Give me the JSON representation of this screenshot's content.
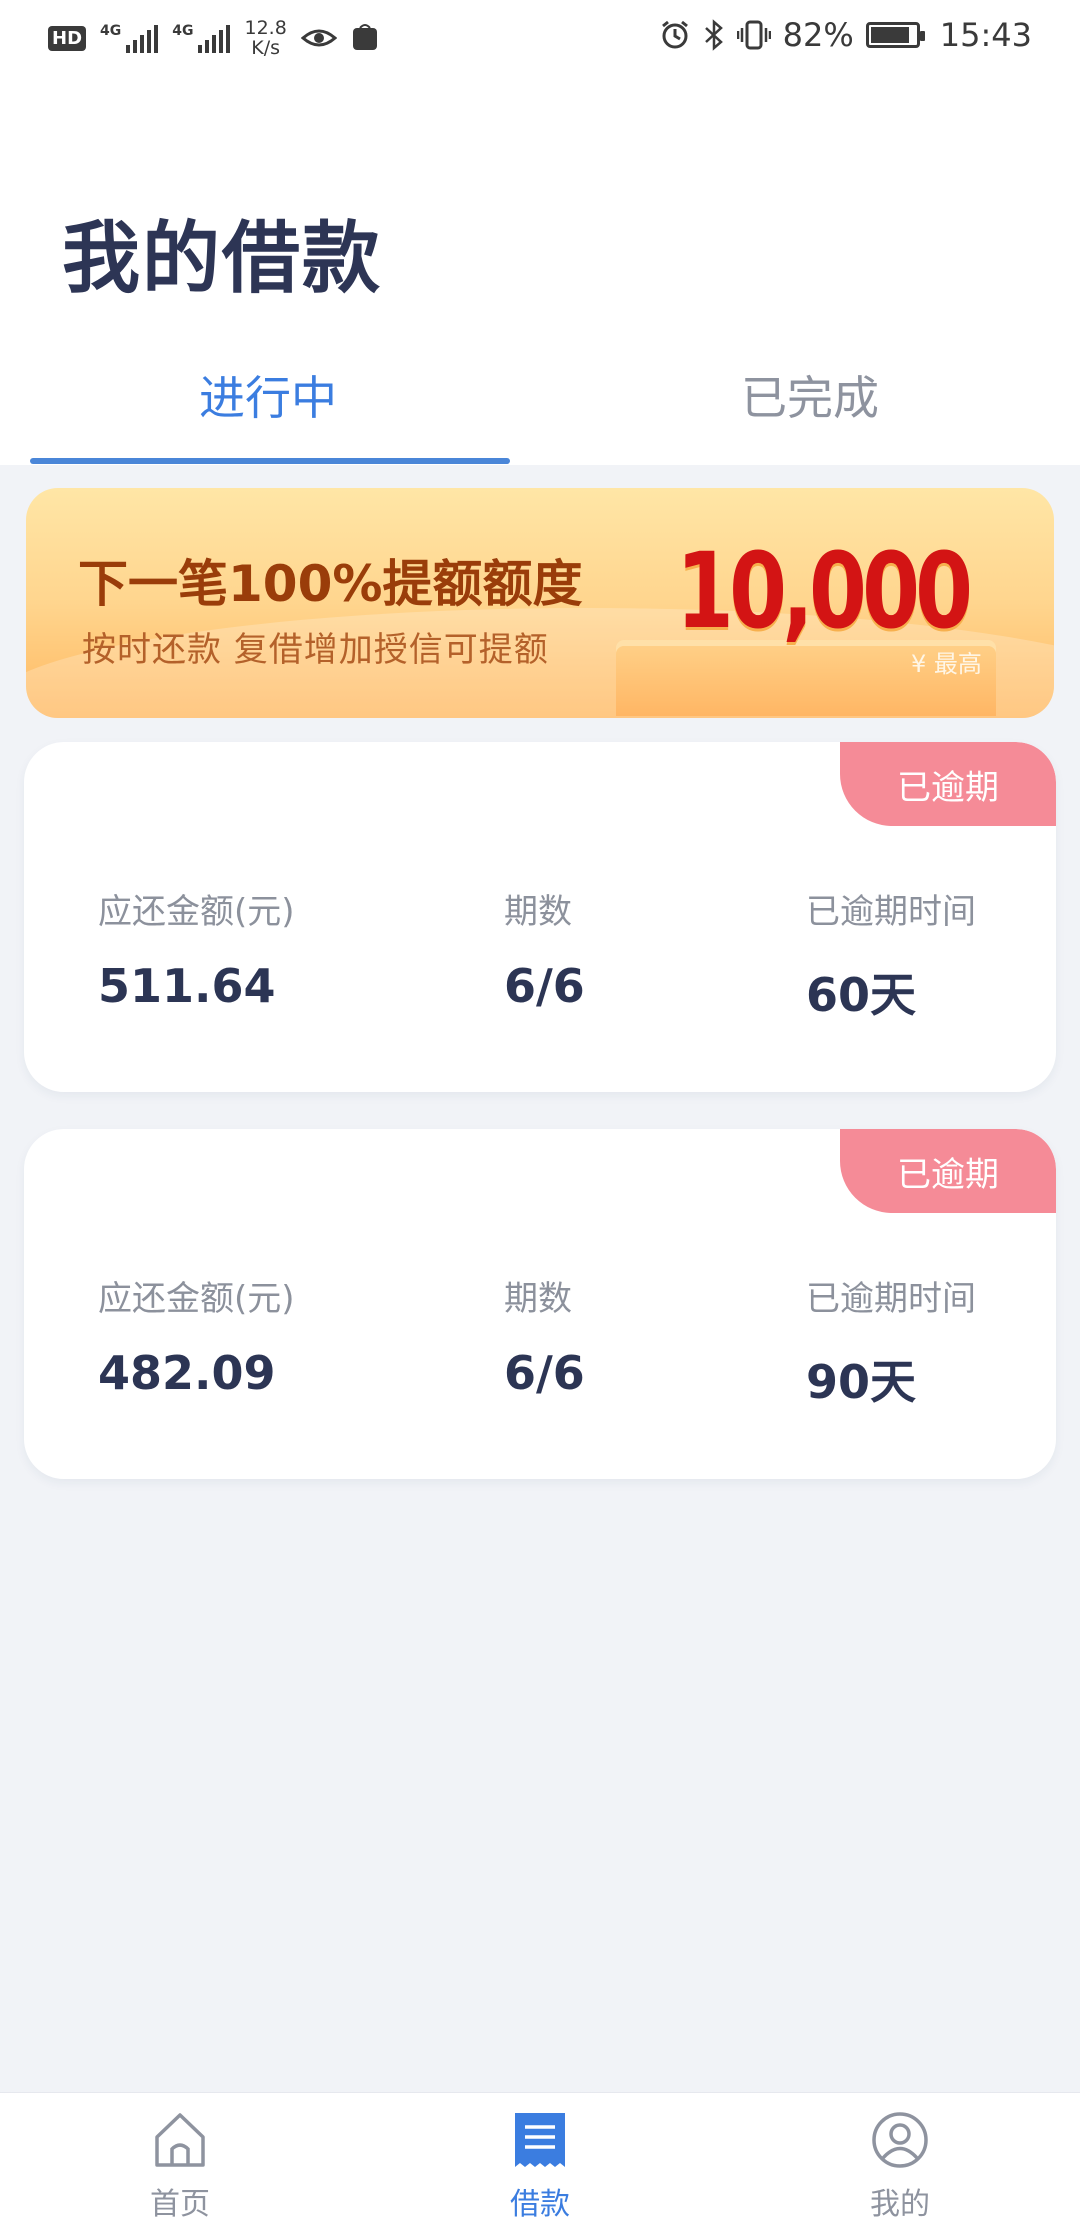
{
  "status_bar": {
    "hd": "HD",
    "sim1_label": "4G",
    "sim2_label": "4G",
    "net_speed_value": "12.8",
    "net_speed_unit": "K/s",
    "battery_percent": "82%",
    "time": "15:43"
  },
  "page": {
    "title": "我的借款"
  },
  "tabs": [
    {
      "label": "进行中",
      "active": true
    },
    {
      "label": "已完成",
      "active": false
    }
  ],
  "banner": {
    "title": "下一笔100%提额额度",
    "subtitle": "按时还款  复借增加授信可提额",
    "amount": "10,000",
    "badge": "¥ 最高"
  },
  "loans": [
    {
      "status": "已逾期",
      "amount_label": "应还金额(元)",
      "amount": "511.64",
      "period_label": "期数",
      "period": "6/6",
      "overdue_label": "已逾期时间",
      "overdue": "60天"
    },
    {
      "status": "已逾期",
      "amount_label": "应还金额(元)",
      "amount": "482.09",
      "period_label": "期数",
      "period": "6/6",
      "overdue_label": "已逾期时间",
      "overdue": "90天"
    }
  ],
  "bottom_nav": [
    {
      "label": "首页",
      "icon": "home-icon"
    },
    {
      "label": "借款",
      "icon": "loan-document-icon",
      "active": true
    },
    {
      "label": "我的",
      "icon": "user-profile-icon"
    }
  ],
  "colors": {
    "accent": "#3b7de0",
    "overdue_badge": "#f58b97",
    "title_text": "#2d3555",
    "banner_amount": "#d31414"
  }
}
